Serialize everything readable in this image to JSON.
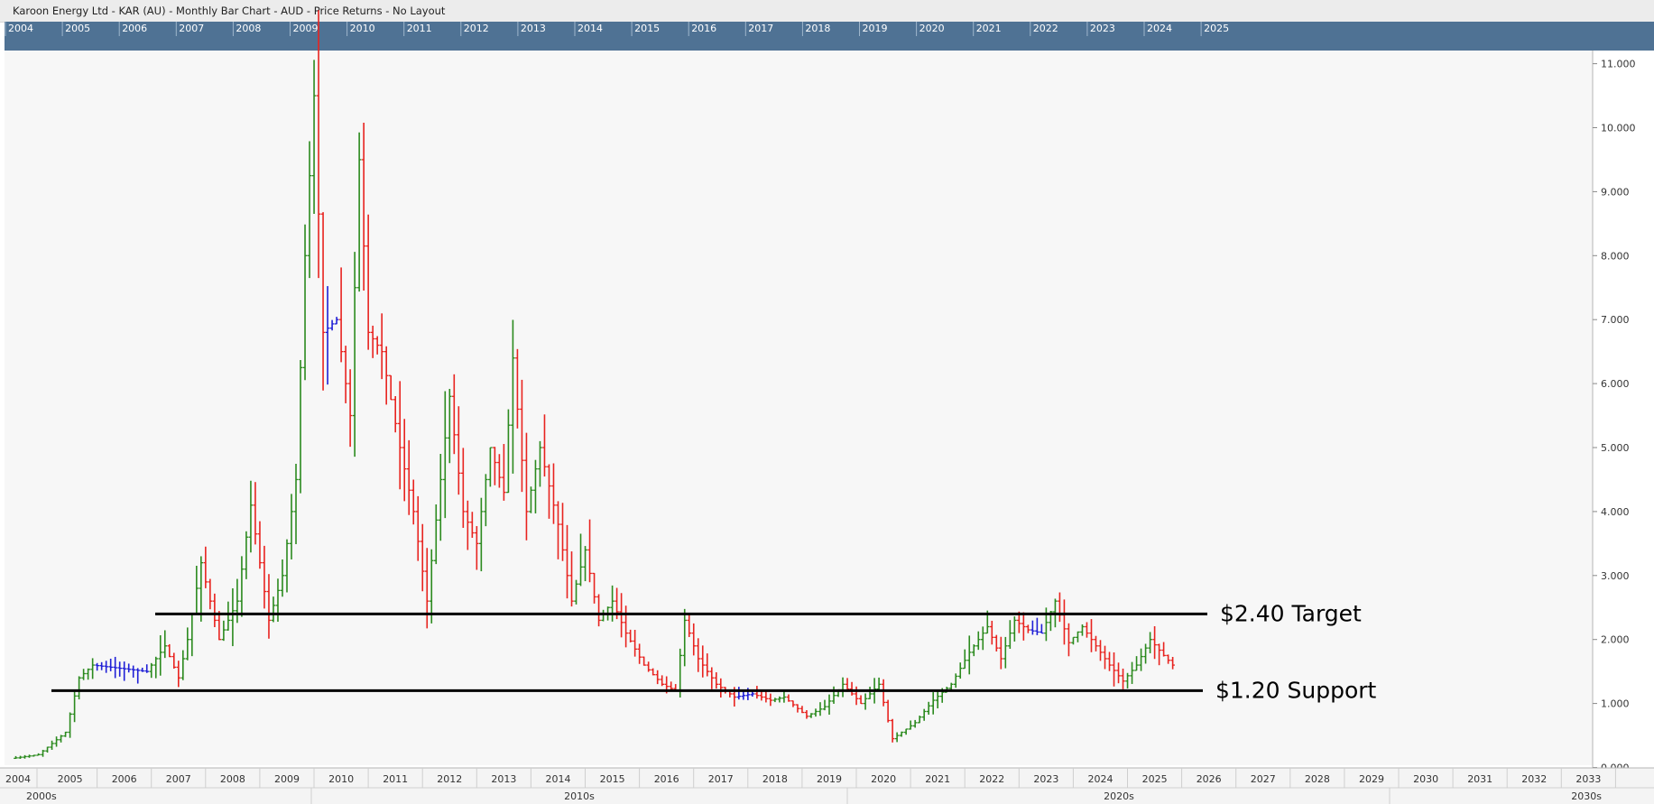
{
  "window": {
    "title": "Karoon Energy Ltd - KAR (AU) - Monthly Bar Chart - AUD - Price Returns - No Layout"
  },
  "navigator": {
    "years": [
      "2004",
      "2005",
      "2006",
      "2007",
      "2008",
      "2009",
      "2010",
      "2011",
      "2012",
      "2013",
      "2014",
      "2015",
      "2016",
      "2017",
      "2018",
      "2019",
      "2020",
      "2021",
      "2022",
      "2023",
      "2024",
      "2025"
    ]
  },
  "colors": {
    "up": "#2b8a1e",
    "down": "#e8231f",
    "neutral": "#1f1fd6",
    "navigator_bg": "#4f7294",
    "plot_bg": "#f7f7f7"
  },
  "annotations": [
    {
      "label": "$2.40 Target",
      "value": 2.4
    },
    {
      "label": "$1.20 Support",
      "value": 1.2
    }
  ],
  "chart_data": {
    "type": "bar",
    "subtype": "ohlc-monthly",
    "title": "",
    "xlabel": "",
    "ylabel": "",
    "y_axis_position": "right",
    "ylim": [
      0,
      11
    ],
    "yticks": [
      "11.000",
      "10.000",
      "9.000",
      "8.000",
      "7.000",
      "6.000",
      "5.000",
      "4.000",
      "3.000",
      "2.000",
      "1.000",
      "0.000"
    ],
    "x_axis": {
      "year_labels": [
        "2004",
        "2005",
        "2006",
        "2007",
        "2008",
        "2009",
        "2010",
        "2011",
        "2012",
        "2013",
        "2014",
        "2015",
        "2016",
        "2017",
        "2018",
        "2019",
        "2020",
        "2021",
        "2022",
        "2023",
        "2024",
        "2025",
        "2026",
        "2027",
        "2028",
        "2029",
        "2030",
        "2031",
        "2032",
        "2033"
      ],
      "decade_labels": [
        "2000s",
        "2010s",
        "2020s",
        "2030s"
      ]
    },
    "price_path": [
      [
        "2004-01",
        0.15
      ],
      [
        "2004-06",
        0.2
      ],
      [
        "2004-12",
        0.55
      ],
      [
        "2005-03",
        1.4
      ],
      [
        "2005-06",
        1.6
      ],
      [
        "2005-12",
        1.55
      ],
      [
        "2006-06",
        1.5
      ],
      [
        "2006-10",
        1.9
      ],
      [
        "2007-01",
        1.4
      ],
      [
        "2007-03",
        2.0
      ],
      [
        "2007-06",
        3.2
      ],
      [
        "2007-10",
        2.0
      ],
      [
        "2008-02",
        2.6
      ],
      [
        "2008-05",
        4.1
      ],
      [
        "2008-09",
        2.3
      ],
      [
        "2008-12",
        3.0
      ],
      [
        "2009-03",
        4.5
      ],
      [
        "2009-05",
        8.0
      ],
      [
        "2009-07",
        10.5
      ],
      [
        "2009-09",
        6.8
      ],
      [
        "2009-12",
        7.0
      ],
      [
        "2010-03",
        5.5
      ],
      [
        "2010-05",
        9.5
      ],
      [
        "2010-07",
        6.8
      ],
      [
        "2010-10",
        6.5
      ],
      [
        "2011-02",
        5.0
      ],
      [
        "2011-05",
        4.0
      ],
      [
        "2011-08",
        2.6
      ],
      [
        "2011-11",
        4.5
      ],
      [
        "2012-01",
        5.8
      ],
      [
        "2012-04",
        4.0
      ],
      [
        "2012-07",
        3.5
      ],
      [
        "2012-10",
        5.0
      ],
      [
        "2013-01",
        4.3
      ],
      [
        "2013-03",
        6.4
      ],
      [
        "2013-06",
        4.0
      ],
      [
        "2013-09",
        5.0
      ],
      [
        "2014-01",
        3.8
      ],
      [
        "2014-04",
        2.6
      ],
      [
        "2014-07",
        3.4
      ],
      [
        "2014-10",
        2.3
      ],
      [
        "2015-01",
        2.6
      ],
      [
        "2015-04",
        2.1
      ],
      [
        "2015-08",
        1.6
      ],
      [
        "2015-12",
        1.3
      ],
      [
        "2016-03",
        1.2
      ],
      [
        "2016-05",
        2.3
      ],
      [
        "2016-08",
        1.7
      ],
      [
        "2016-12",
        1.3
      ],
      [
        "2017-04",
        1.1
      ],
      [
        "2017-08",
        1.15
      ],
      [
        "2017-12",
        1.05
      ],
      [
        "2018-03",
        1.1
      ],
      [
        "2018-08",
        0.8
      ],
      [
        "2018-12",
        0.95
      ],
      [
        "2019-04",
        1.3
      ],
      [
        "2019-08",
        1.0
      ],
      [
        "2019-12",
        1.3
      ],
      [
        "2020-03",
        0.45
      ],
      [
        "2020-08",
        0.7
      ],
      [
        "2020-12",
        1.05
      ],
      [
        "2021-04",
        1.3
      ],
      [
        "2021-08",
        1.8
      ],
      [
        "2021-12",
        2.2
      ],
      [
        "2022-03",
        1.7
      ],
      [
        "2022-06",
        2.3
      ],
      [
        "2022-09",
        2.15
      ],
      [
        "2022-12",
        2.1
      ],
      [
        "2023-03",
        2.6
      ],
      [
        "2023-06",
        1.95
      ],
      [
        "2023-09",
        2.2
      ],
      [
        "2023-12",
        1.9
      ],
      [
        "2024-03",
        1.6
      ],
      [
        "2024-06",
        1.35
      ],
      [
        "2024-09",
        1.6
      ],
      [
        "2024-12",
        2.0
      ],
      [
        "2025-03",
        1.75
      ],
      [
        "2025-05",
        1.6
      ]
    ]
  }
}
